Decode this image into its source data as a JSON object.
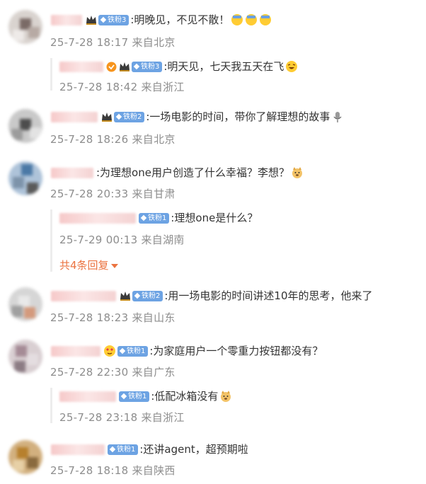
{
  "comments": [
    {
      "badge": "铁粉3",
      "text": ":明晚见，不见不散！",
      "meta": "25-7-28 18:17 来自北京",
      "emoji": "bowing-face-emoji"
    },
    {
      "badge": "铁粉3",
      "text": ":明天见，七天我五天在飞",
      "meta": "25-7-28 18:42 来自浙江",
      "emoji": "laughing-face-emoji"
    },
    {
      "badge": "铁粉2",
      "text": ":一场电影的时间，带你了解理想的故事",
      "meta": "25-7-28 18:26 来自北京",
      "emoji": "microphone-emoji"
    },
    {
      "text": ":为理想one用户创造了什么幸福？李想？",
      "meta": "25-7-28 20:33 来自甘肃",
      "emoji": "doge-face-emoji"
    },
    {
      "badge": "铁粉1",
      "text": ":理想one是什么？",
      "meta": "25-7-29 00:13 来自湖南"
    },
    {
      "more_label": "共4条回复"
    },
    {
      "badge": "铁粉2",
      "text": ":用一场电影的时间讲述10年的思考，他来了",
      "meta": "25-7-28 18:23 来自山东"
    },
    {
      "badge": "铁粉1",
      "text": ":为家庭用户一个零重力按钮都没有？",
      "meta": "25-7-28 22:30 来自广东"
    },
    {
      "badge": "铁粉1",
      "text": ":低配冰箱没有",
      "meta": "25-7-28 23:18 来自浙江",
      "emoji": "doge-face-emoji"
    },
    {
      "badge": "铁粉1",
      "text": ":还讲agent，超预期啦",
      "meta": "25-7-28 18:18 来自陕西"
    }
  ],
  "colors": {
    "badge": "#6da3e3",
    "meta": "#8d8d8d",
    "more": "#eb7340",
    "crown": "#c28a1e"
  }
}
